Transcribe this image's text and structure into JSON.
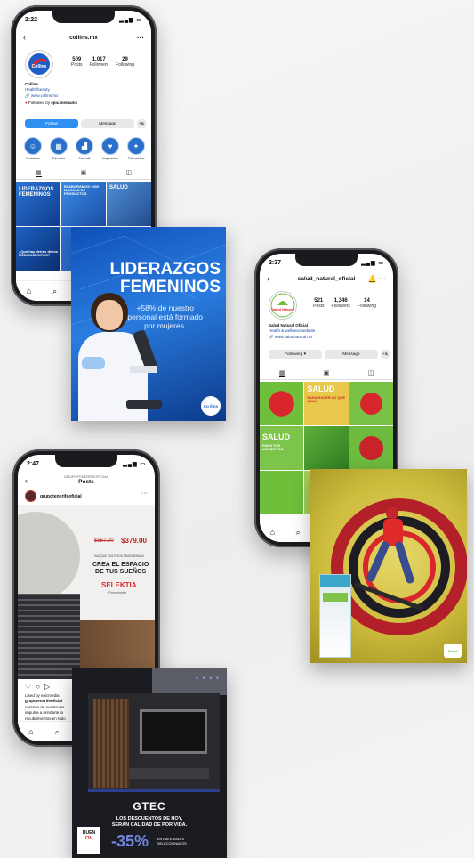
{
  "phone1": {
    "time": "2:22",
    "username": "collins.mx",
    "avatar_logo": "Collins",
    "posts_count": "509",
    "posts_label": "Posts",
    "followers_count": "1,017",
    "followers_label": "Followers",
    "following_count": "29",
    "following_label": "Following",
    "name": "Collins",
    "category": "Health/beauty",
    "website": "www.collins.mx",
    "followed_by_prefix": "Followed by",
    "followed_by_user": "epic.mediamx",
    "follow_button": "Follow",
    "message_button": "Message",
    "add_user_glyph": "+&",
    "highlights": [
      "Nosotros",
      "Eventos",
      "Farmali",
      "Inspiración",
      "Patrocinios"
    ],
    "grid_text_1": "LIDERAZGOS FEMENINOS",
    "grid_text_2": "ELABORAMOS +400 MARCAS DE PRODUCTOS",
    "grid_text_3": "SALUD",
    "grid_text_4": "¿Qué hay detrás de los MEDICAMENTOS?"
  },
  "card1": {
    "headline_1": "LIDERAZGOS",
    "headline_2": "FEMENINOS",
    "sub_1": "+58% de nuestro",
    "sub_2": "personal está formado",
    "sub_3": "por mujeres.",
    "logo": "Co llins"
  },
  "phone2": {
    "time": "2:37",
    "username": "salud_natural_oficial",
    "avatar_logo": "Salud Natural",
    "posts_count": "521",
    "posts_label": "Posts",
    "followers_count": "1,346",
    "followers_label": "Followers",
    "following_count": "14",
    "following_label": "Following",
    "name": "Salud Natural Oficial",
    "category": "Health & wellness website",
    "website": "www.saludnatural.mx",
    "following_button": "Following",
    "message_button": "Message",
    "add_user_glyph": "+&",
    "grid_text_1": "SALUD",
    "grid_text_1b": "PARA HACER LO QUE AMAS",
    "grid_text_2": "SALUD",
    "grid_text_2b": "PARA TUS MOMENTOS"
  },
  "card2": {
    "logo": "Salud"
  },
  "phone3": {
    "time": "2:47",
    "header_small": "GRUPOTENERIFEOFICIAL",
    "header_title": "Posts",
    "username": "grupotenerifeoficial",
    "old_price": "$567.00",
    "new_price": "$379.00",
    "promo_small": "HAZ QUE TUS PISOS TRASCIENDAN",
    "headline_1": "CREA EL ESPACIO",
    "headline_2": "DE TUS SUEÑOS",
    "brand": "SELEKTIA",
    "brand_sub": "Porcelanite",
    "liked_by": "Liked by epicmedia",
    "caption_user": "grupotenerifeoficial",
    "caption_1": "corazón de nuestro es",
    "caption_2": "impulsa a brindarte la",
    "caption_3": "recubrimientos en todo"
  },
  "card3": {
    "dots": "• • • •",
    "brand": "GTEC",
    "line_1": "LOS DESCUENTOS DE HOY,",
    "line_2_a": "SERÁN",
    "line_2_b": "CALIDAD DE POR VIDA.",
    "discount": "-35%",
    "discount_note_1": "EN MATERIALES",
    "discount_note_2": "SELECCIONADOS",
    "buenfin_1": "BUEN",
    "buenfin_2": "FIN"
  },
  "colors": {
    "instagram_blue": "#2d8ff0",
    "collins_blue": "#1f5fc4",
    "salud_green": "#6fbf3b",
    "salud_red": "#d8262c",
    "gtec_navy": "#1e2a5a"
  }
}
